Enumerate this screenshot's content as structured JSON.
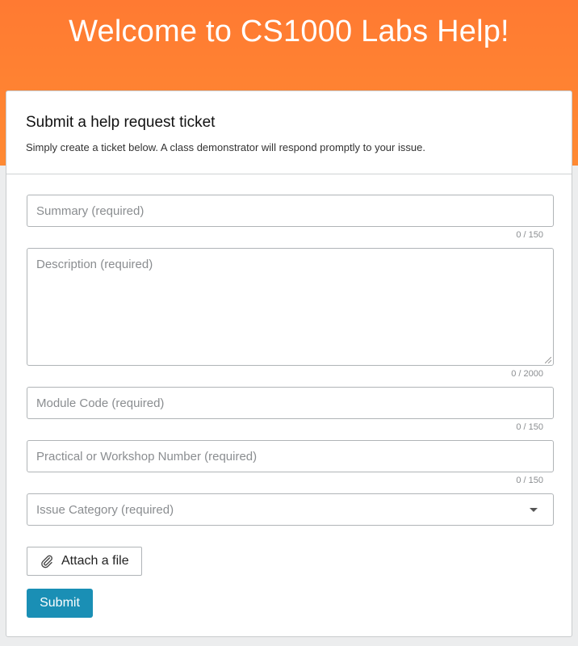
{
  "header": {
    "title": "Welcome to CS1000 Labs Help!"
  },
  "ticket_form": {
    "title": "Submit a help request ticket",
    "subtitle": "Simply create a ticket below. A class demonstrator will respond promptly to your issue.",
    "fields": {
      "summary": {
        "placeholder": "Summary (required)",
        "counter": "0 / 150"
      },
      "description": {
        "placeholder": "Description (required)",
        "counter": "0 / 2000"
      },
      "module_code": {
        "placeholder": "Module Code (required)",
        "counter": "0 / 150"
      },
      "practical_number": {
        "placeholder": "Practical or Workshop Number (required)",
        "counter": "0 / 150"
      },
      "issue_category": {
        "placeholder": "Issue Category (required)"
      }
    },
    "attach_label": "Attach a file",
    "submit_label": "Submit"
  },
  "colors": {
    "header_bg": "#ff7f32",
    "submit_bg": "#1a8fb5"
  },
  "icons": {
    "attach": "paperclip-icon",
    "select": "caret-down-icon"
  }
}
